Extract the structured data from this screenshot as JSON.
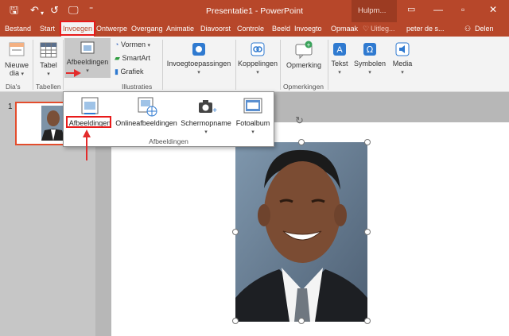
{
  "window": {
    "title": "Presentatie1 - PowerPoint",
    "help_tab": "Hulpm...",
    "qa_save": "🖫",
    "qa_undo": "↶",
    "qa_redo": "↺",
    "qa_present": "🖵",
    "qa_more": "⁼",
    "minimize": "—",
    "restore": "▫",
    "close": "✕",
    "options": "▭"
  },
  "tabs": [
    "Bestand",
    "Start",
    "Invoegen",
    "Ontwerpe",
    "Overgang",
    "Animatie",
    "Diavoorst",
    "Controle",
    "Beeld",
    "Invoegto",
    "Opmaak"
  ],
  "active_tab": "Invoegen",
  "search_placeholder": "Uitleg...",
  "user": "peter de s...",
  "share_label": "Delen",
  "ribbon": {
    "new_slide": {
      "line1": "Nieuwe",
      "line2": "dia"
    },
    "table": "Tabel",
    "pictures": "Afbeeldingen",
    "shapes": "Vormen",
    "smartart": "SmartArt",
    "chart": "Grafiek",
    "addins": "Invoegtoepassingen",
    "links": "Koppelingen",
    "comment": "Opmerking",
    "text": "Tekst",
    "symbols": "Symbolen",
    "media": "Media",
    "groups": {
      "slides": "Dia's",
      "tables": "Tabellen",
      "illustrations": "Illustraties",
      "comments": "Opmerkingen"
    }
  },
  "popup": {
    "items": [
      "Afbeeldingen",
      "Onlineafbeeldingen",
      "Schermopname",
      "Fotoalbum"
    ],
    "group_label": "Afbeeldingen"
  },
  "thumbnail_number": "1",
  "colors": {
    "accent": "#b7472a",
    "highlight": "#e81a1a"
  }
}
